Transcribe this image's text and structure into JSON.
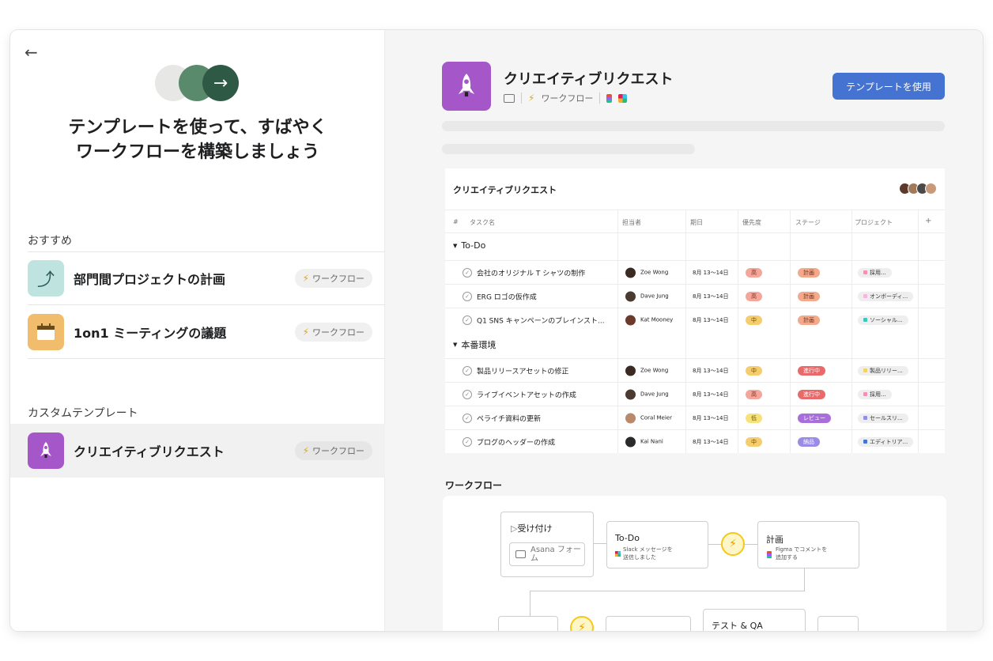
{
  "left": {
    "back_icon": "arrow-left-icon",
    "headline_line1": "テンプレートを使って、すばやく",
    "headline_line2": "ワークフローを構築しましょう",
    "recommended_label": "おすすめ",
    "recommended": [
      {
        "name": "部門間プロジェクトの計画",
        "badge": "ワークフロー",
        "icon": "route-icon",
        "color": "#bfe3df"
      },
      {
        "name": "1on1 ミーティングの議題",
        "badge": "ワークフロー",
        "icon": "calendar-icon",
        "color": "#f1bd6c"
      }
    ],
    "custom_label": "カスタムテンプレート",
    "custom": [
      {
        "name": "クリエイティブリクエスト",
        "badge": "ワークフロー",
        "icon": "rocket-icon",
        "color": "#a556c9"
      }
    ]
  },
  "right": {
    "title": "クリエイティブリクエスト",
    "meta_workflow": "ワークフロー",
    "use_button": "テンプレートを使用",
    "table": {
      "title": "クリエイティブリクエスト",
      "headers": [
        "#",
        "タスク名",
        "担当者",
        "期日",
        "優先度",
        "ステージ",
        "プロジェクト",
        "+"
      ],
      "groups": [
        {
          "name": "To-Do",
          "rows": [
            {
              "task": "会社のオリジナル T シャツの制作",
              "assignee": "Zoe Wong",
              "due": "8月 13〜14日",
              "priority": "高",
              "stage": "計画",
              "project": "採用..."
            },
            {
              "task": "ERG ロゴの仮作成",
              "assignee": "Dave Jung",
              "due": "8月 13〜14日",
              "priority": "高",
              "stage": "計画",
              "project": "オンボーディ..."
            },
            {
              "task": "Q1 SNS キャンペーンのブレインスト...",
              "assignee": "Kat Mooney",
              "due": "8月 13〜14日",
              "priority": "中",
              "stage": "計画",
              "project": "ソーシャル..."
            }
          ]
        },
        {
          "name": "本番環境",
          "rows": [
            {
              "task": "製品リリースアセットの修正",
              "assignee": "Zoe Wong",
              "due": "8月 13〜14日",
              "priority": "中",
              "stage": "進行中",
              "project": "製品リリー..."
            },
            {
              "task": "ライブイベントアセットの作成",
              "assignee": "Dave Jung",
              "due": "8月 13〜14日",
              "priority": "高",
              "stage": "進行中",
              "project": "採用..."
            },
            {
              "task": "ペライチ資料の更新",
              "assignee": "Coral Meier",
              "due": "8月 13〜14日",
              "priority": "低",
              "stage": "レビュー",
              "project": "セールスリ..."
            },
            {
              "task": "ブログのヘッダーの作成",
              "assignee": "Kai Nani",
              "due": "8月 13〜14日",
              "priority": "中",
              "stage": "納品",
              "project": "エディトリア..."
            }
          ]
        }
      ]
    },
    "workflow": {
      "title": "ワークフロー",
      "intake_title": "受け付け",
      "intake_form": "Asana フォーム",
      "todo_title": "To-Do",
      "todo_sub1": "Slack メッセージを",
      "todo_sub2": "送信しました",
      "plan_title": "計画",
      "plan_sub1": "Figma でコメントを",
      "plan_sub2": "追加する",
      "qa_title": "テスト & QA"
    }
  },
  "colors": {
    "accent": "#4573d2",
    "prio": {
      "高": [
        "#f4a69a",
        "#7a2b1f"
      ],
      "中": [
        "#f5cd6e",
        "#6b4b00"
      ],
      "低": [
        "#f7e27a",
        "#6b5a00"
      ]
    },
    "stage": {
      "計画": [
        "#f3a98b",
        "#6a2a14"
      ],
      "進行中": [
        "#e86a6a",
        "#ffffff"
      ],
      "レビュー": [
        "#a86fdc",
        "#ffffff"
      ],
      "納品": [
        "#9b8be6",
        "#ffffff"
      ]
    },
    "project": [
      "#f290b8",
      "#f3b6de",
      "#3fc6bd",
      "#f1d36c",
      "#f290b8",
      "#8f8ee8",
      "#4573d2"
    ]
  }
}
